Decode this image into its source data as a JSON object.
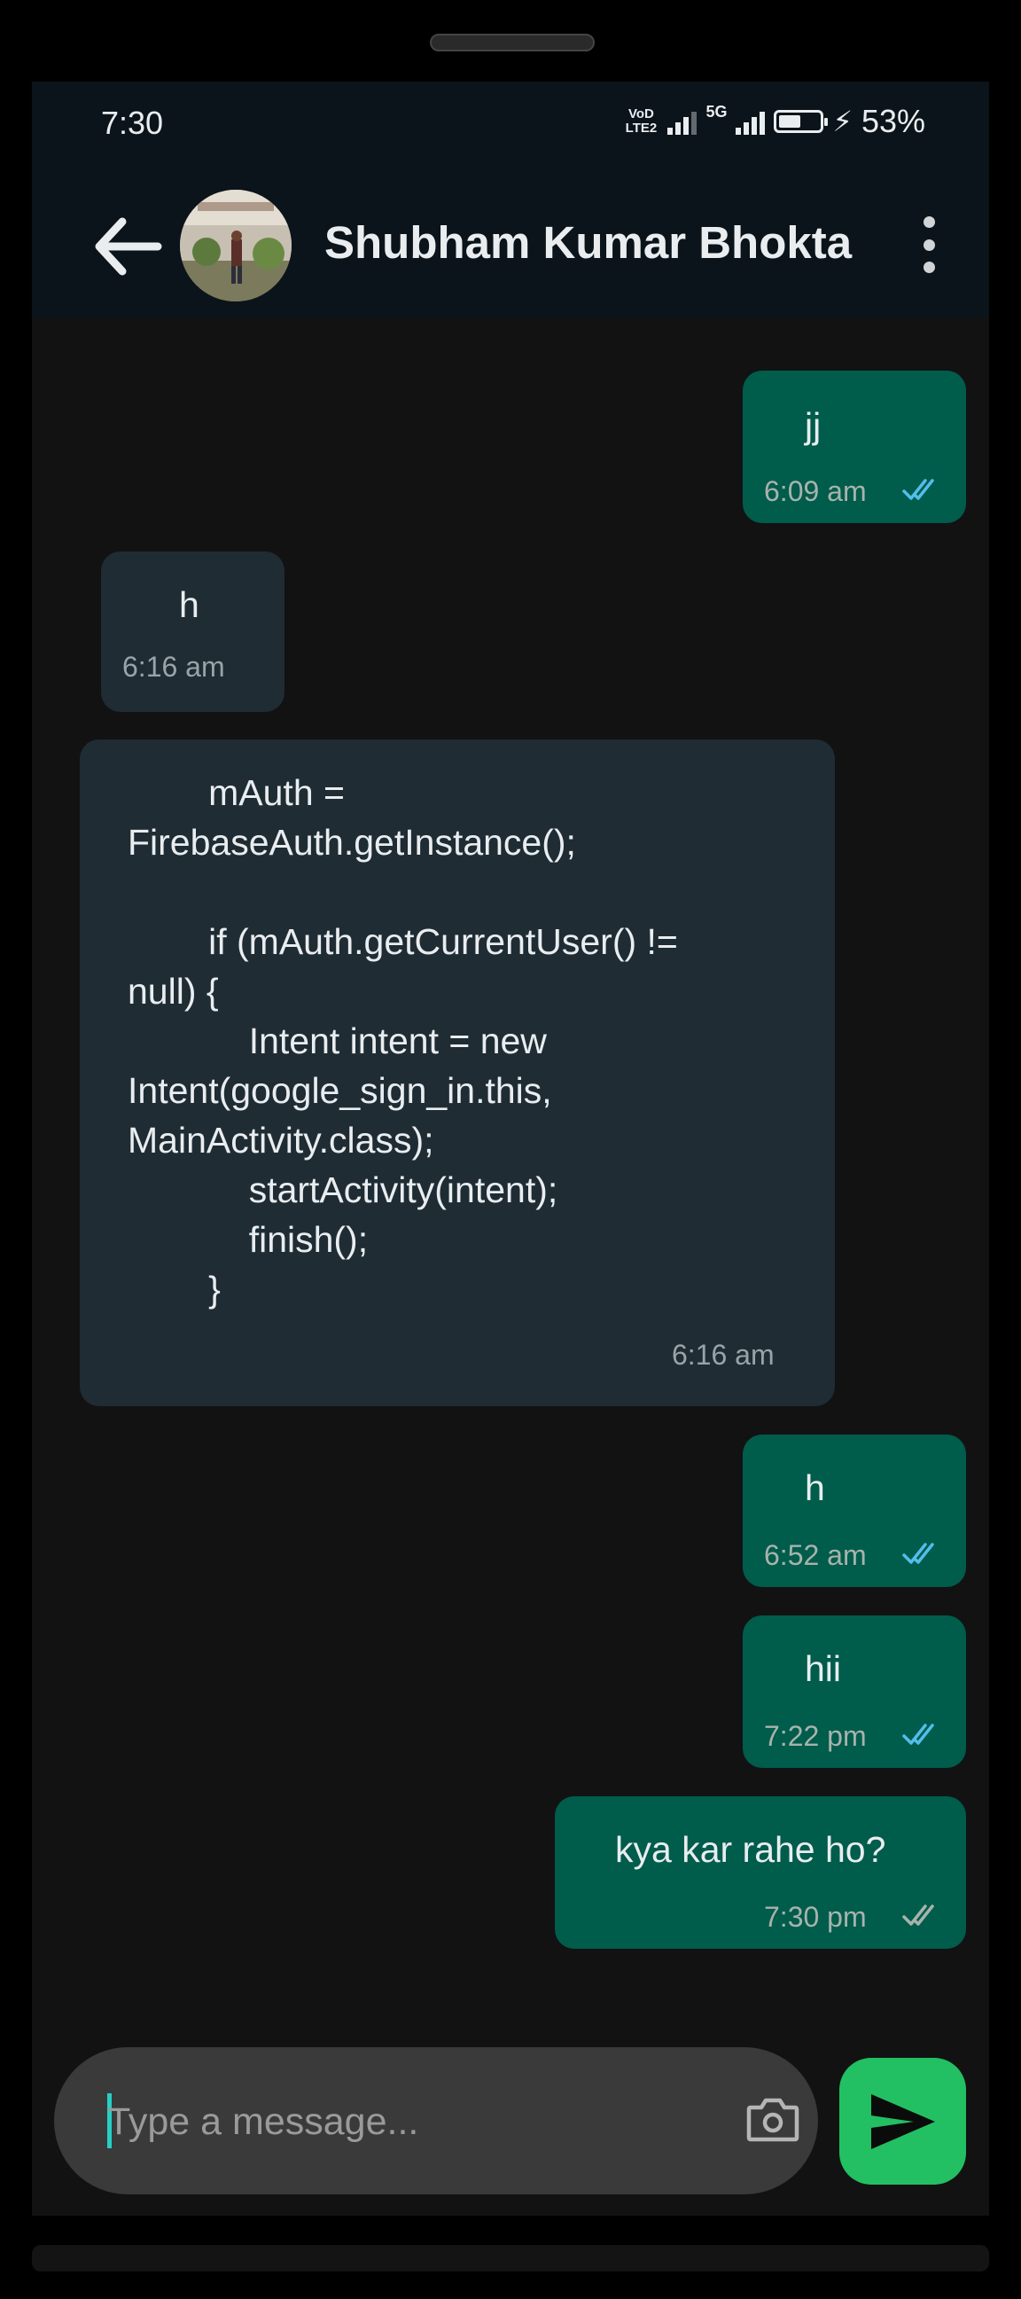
{
  "status_bar": {
    "time": "7:30",
    "network_1": "VoD LTE2",
    "network_2": "5G",
    "battery_percent": "53%",
    "battery_level": 0.53,
    "charging_icon": "bolt-icon"
  },
  "header": {
    "back_icon": "arrow-left-icon",
    "contact_name": "Shubham Kumar Bhokta",
    "menu_icon": "more-vert-icon"
  },
  "messages": [
    {
      "direction": "out",
      "text": "jj",
      "time": "6:09 am",
      "status": "read"
    },
    {
      "direction": "in",
      "text": "h",
      "time": "6:16 am"
    },
    {
      "direction": "in",
      "text": "        mAuth =\nFirebaseAuth.getInstance();\n\n        if (mAuth.getCurrentUser() !=\nnull) {\n            Intent intent = new\nIntent(google_sign_in.this,\nMainActivity.class);\n            startActivity(intent);\n            finish();\n        }",
      "time": "6:16 am"
    },
    {
      "direction": "out",
      "text": "h",
      "time": "6:52 am",
      "status": "read"
    },
    {
      "direction": "out",
      "text": "hii",
      "time": "7:22 pm",
      "status": "read"
    },
    {
      "direction": "out",
      "text": "kya kar rahe ho?",
      "time": "7:30 pm",
      "status": "delivered"
    }
  ],
  "composer": {
    "placeholder": "Type a message...",
    "camera_icon": "camera-icon",
    "send_icon": "send-icon"
  },
  "colors": {
    "outgoing_bubble": "#005c4b",
    "incoming_bubble": "#1f2c34",
    "read_tick": "#53bdeb",
    "delivered_tick": "#a7b3ad",
    "send_button": "#22c063",
    "app_bar": "#0b141a"
  }
}
